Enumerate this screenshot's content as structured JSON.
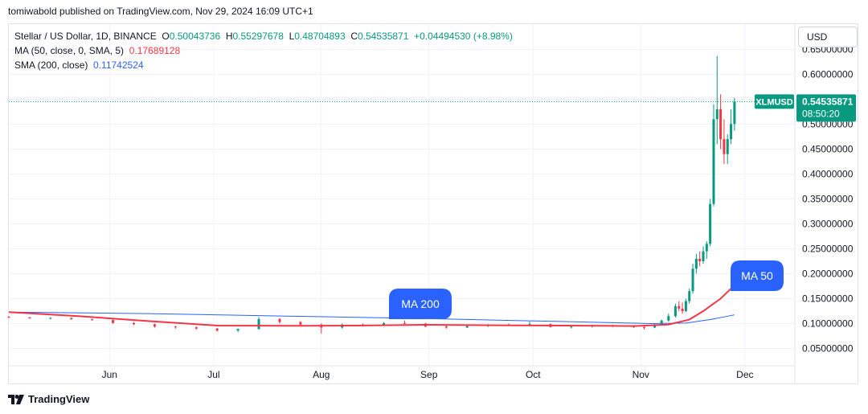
{
  "publisher_line": "tomiwabold published on TradingView.com, Nov 29, 2024 16:09 UTC+1",
  "legend": {
    "symbol": "Stellar / US Dollar, 1D, BINANCE",
    "o_label": "O",
    "o": "0.50043736",
    "h_label": "H",
    "h": "0.55297678",
    "l_label": "L",
    "l": "0.48704893",
    "c_label": "C",
    "c": "0.54535871",
    "change": "+0.04494530 (+8.98%)",
    "ma_label": "MA (50, close, 0, SMA, 5)",
    "ma_value": "0.17689128",
    "sma_label": "SMA (200, close)",
    "sma_value": "0.11742524"
  },
  "currency_button": "USD",
  "price_tag": {
    "symbol": "XLMUSD",
    "price": "0.54535871",
    "countdown": "08:50:20"
  },
  "annotations": {
    "ma200": "MA 200",
    "ma50": "MA 50"
  },
  "footer": {
    "brand": "TradingView"
  },
  "colors": {
    "up": "#089981",
    "down": "#f23645",
    "ma50": "#f23645",
    "sma200": "#2962ff",
    "grid": "#f0f3fa",
    "bubble": "#2962ff"
  },
  "chart_data": {
    "type": "candlestick",
    "symbol": "XLMUSD",
    "interval": "1D",
    "y_ticks": [
      "0.65000000",
      "0.60000000",
      "0.55000000",
      "0.50000000",
      "0.45000000",
      "0.40000000",
      "0.35000000",
      "0.30000000",
      "0.25000000",
      "0.20000000",
      "0.15000000",
      "0.10000000",
      "0.05000000"
    ],
    "y_tick_values": [
      0.65,
      0.6,
      0.55,
      0.5,
      0.45,
      0.4,
      0.35,
      0.3,
      0.25,
      0.2,
      0.15,
      0.1,
      0.05
    ],
    "ylim": [
      0.0,
      0.66
    ],
    "x_ticks": [
      {
        "label": "Jun",
        "day": 29
      },
      {
        "label": "Jul",
        "day": 59
      },
      {
        "label": "Aug",
        "day": 90
      },
      {
        "label": "Sep",
        "day": 121
      },
      {
        "label": "Oct",
        "day": 151
      },
      {
        "label": "Nov",
        "day": 182
      },
      {
        "label": "Dec",
        "day": 212
      }
    ],
    "x_range_days": [
      0,
      222
    ],
    "grid": true,
    "candles": [
      {
        "day": 0,
        "o": 0.1135,
        "h": 0.115,
        "l": 0.111,
        "c": 0.112
      },
      {
        "day": 6,
        "o": 0.112,
        "h": 0.1135,
        "l": 0.1095,
        "c": 0.1105
      },
      {
        "day": 12,
        "o": 0.1105,
        "h": 0.113,
        "l": 0.109,
        "c": 0.111
      },
      {
        "day": 18,
        "o": 0.111,
        "h": 0.1125,
        "l": 0.108,
        "c": 0.1085
      },
      {
        "day": 24,
        "o": 0.1085,
        "h": 0.11,
        "l": 0.106,
        "c": 0.107
      },
      {
        "day": 30,
        "o": 0.107,
        "h": 0.108,
        "l": 0.1,
        "c": 0.101
      },
      {
        "day": 36,
        "o": 0.101,
        "h": 0.103,
        "l": 0.097,
        "c": 0.0985
      },
      {
        "day": 42,
        "o": 0.0985,
        "h": 0.1,
        "l": 0.092,
        "c": 0.094
      },
      {
        "day": 48,
        "o": 0.094,
        "h": 0.0955,
        "l": 0.09,
        "c": 0.0925
      },
      {
        "day": 54,
        "o": 0.0925,
        "h": 0.094,
        "l": 0.088,
        "c": 0.09
      },
      {
        "day": 60,
        "o": 0.09,
        "h": 0.0915,
        "l": 0.084,
        "c": 0.086
      },
      {
        "day": 66,
        "o": 0.086,
        "h": 0.09,
        "l": 0.083,
        "c": 0.089
      },
      {
        "day": 72,
        "o": 0.089,
        "h": 0.113,
        "l": 0.088,
        "c": 0.109
      },
      {
        "day": 78,
        "o": 0.109,
        "h": 0.111,
        "l": 0.1,
        "c": 0.103
      },
      {
        "day": 84,
        "o": 0.103,
        "h": 0.105,
        "l": 0.095,
        "c": 0.098
      },
      {
        "day": 90,
        "o": 0.098,
        "h": 0.1,
        "l": 0.08,
        "c": 0.092
      },
      {
        "day": 96,
        "o": 0.092,
        "h": 0.1,
        "l": 0.09,
        "c": 0.098
      },
      {
        "day": 102,
        "o": 0.098,
        "h": 0.1,
        "l": 0.094,
        "c": 0.096
      },
      {
        "day": 108,
        "o": 0.096,
        "h": 0.103,
        "l": 0.095,
        "c": 0.101
      },
      {
        "day": 114,
        "o": 0.101,
        "h": 0.106,
        "l": 0.099,
        "c": 0.1
      },
      {
        "day": 120,
        "o": 0.1,
        "h": 0.101,
        "l": 0.093,
        "c": 0.094
      },
      {
        "day": 126,
        "o": 0.094,
        "h": 0.096,
        "l": 0.09,
        "c": 0.092
      },
      {
        "day": 132,
        "o": 0.092,
        "h": 0.096,
        "l": 0.091,
        "c": 0.095
      },
      {
        "day": 138,
        "o": 0.095,
        "h": 0.099,
        "l": 0.093,
        "c": 0.097
      },
      {
        "day": 144,
        "o": 0.097,
        "h": 0.1,
        "l": 0.095,
        "c": 0.098
      },
      {
        "day": 150,
        "o": 0.098,
        "h": 0.104,
        "l": 0.096,
        "c": 0.099
      },
      {
        "day": 156,
        "o": 0.099,
        "h": 0.1,
        "l": 0.092,
        "c": 0.093
      },
      {
        "day": 162,
        "o": 0.093,
        "h": 0.096,
        "l": 0.09,
        "c": 0.094
      },
      {
        "day": 168,
        "o": 0.094,
        "h": 0.098,
        "l": 0.092,
        "c": 0.096
      },
      {
        "day": 174,
        "o": 0.096,
        "h": 0.098,
        "l": 0.093,
        "c": 0.095
      },
      {
        "day": 180,
        "o": 0.095,
        "h": 0.097,
        "l": 0.091,
        "c": 0.093
      },
      {
        "day": 183,
        "o": 0.093,
        "h": 0.096,
        "l": 0.088,
        "c": 0.092
      },
      {
        "day": 186,
        "o": 0.092,
        "h": 0.1,
        "l": 0.091,
        "c": 0.098
      },
      {
        "day": 188,
        "o": 0.098,
        "h": 0.108,
        "l": 0.097,
        "c": 0.106
      },
      {
        "day": 190,
        "o": 0.106,
        "h": 0.12,
        "l": 0.104,
        "c": 0.115
      },
      {
        "day": 192,
        "o": 0.115,
        "h": 0.14,
        "l": 0.112,
        "c": 0.135
      },
      {
        "day": 193,
        "o": 0.135,
        "h": 0.145,
        "l": 0.125,
        "c": 0.13
      },
      {
        "day": 194,
        "o": 0.13,
        "h": 0.142,
        "l": 0.12,
        "c": 0.125
      },
      {
        "day": 195,
        "o": 0.125,
        "h": 0.15,
        "l": 0.123,
        "c": 0.145
      },
      {
        "day": 196,
        "o": 0.145,
        "h": 0.17,
        "l": 0.14,
        "c": 0.165
      },
      {
        "day": 197,
        "o": 0.165,
        "h": 0.22,
        "l": 0.16,
        "c": 0.21
      },
      {
        "day": 198,
        "o": 0.21,
        "h": 0.24,
        "l": 0.2,
        "c": 0.23
      },
      {
        "day": 199,
        "o": 0.23,
        "h": 0.245,
        "l": 0.215,
        "c": 0.225
      },
      {
        "day": 200,
        "o": 0.225,
        "h": 0.255,
        "l": 0.22,
        "c": 0.245
      },
      {
        "day": 201,
        "o": 0.245,
        "h": 0.265,
        "l": 0.23,
        "c": 0.26
      },
      {
        "day": 202,
        "o": 0.26,
        "h": 0.35,
        "l": 0.255,
        "c": 0.34
      },
      {
        "day": 203,
        "o": 0.34,
        "h": 0.54,
        "l": 0.335,
        "c": 0.51
      },
      {
        "day": 204,
        "o": 0.51,
        "h": 0.637,
        "l": 0.46,
        "c": 0.53
      },
      {
        "day": 205,
        "o": 0.53,
        "h": 0.56,
        "l": 0.45,
        "c": 0.47
      },
      {
        "day": 206,
        "o": 0.47,
        "h": 0.51,
        "l": 0.42,
        "c": 0.44
      },
      {
        "day": 207,
        "o": 0.44,
        "h": 0.48,
        "l": 0.42,
        "c": 0.47
      },
      {
        "day": 208,
        "o": 0.47,
        "h": 0.53,
        "l": 0.46,
        "c": 0.5004
      },
      {
        "day": 209,
        "o": 0.50043736,
        "h": 0.55297678,
        "l": 0.48704893,
        "c": 0.54535871
      }
    ],
    "ma50": [
      {
        "day": 0,
        "v": 0.123
      },
      {
        "day": 20,
        "v": 0.115
      },
      {
        "day": 40,
        "v": 0.105
      },
      {
        "day": 60,
        "v": 0.096
      },
      {
        "day": 80,
        "v": 0.0955
      },
      {
        "day": 100,
        "v": 0.096
      },
      {
        "day": 120,
        "v": 0.0975
      },
      {
        "day": 140,
        "v": 0.0965
      },
      {
        "day": 160,
        "v": 0.096
      },
      {
        "day": 180,
        "v": 0.095
      },
      {
        "day": 190,
        "v": 0.098
      },
      {
        "day": 196,
        "v": 0.108
      },
      {
        "day": 200,
        "v": 0.125
      },
      {
        "day": 205,
        "v": 0.15
      },
      {
        "day": 209,
        "v": 0.17689128
      }
    ],
    "sma200": [
      {
        "day": 0,
        "v": 0.123
      },
      {
        "day": 40,
        "v": 0.12
      },
      {
        "day": 80,
        "v": 0.115
      },
      {
        "day": 120,
        "v": 0.11
      },
      {
        "day": 160,
        "v": 0.104
      },
      {
        "day": 185,
        "v": 0.1
      },
      {
        "day": 195,
        "v": 0.101
      },
      {
        "day": 202,
        "v": 0.108
      },
      {
        "day": 209,
        "v": 0.11742524
      }
    ],
    "last_price": 0.54535871
  }
}
